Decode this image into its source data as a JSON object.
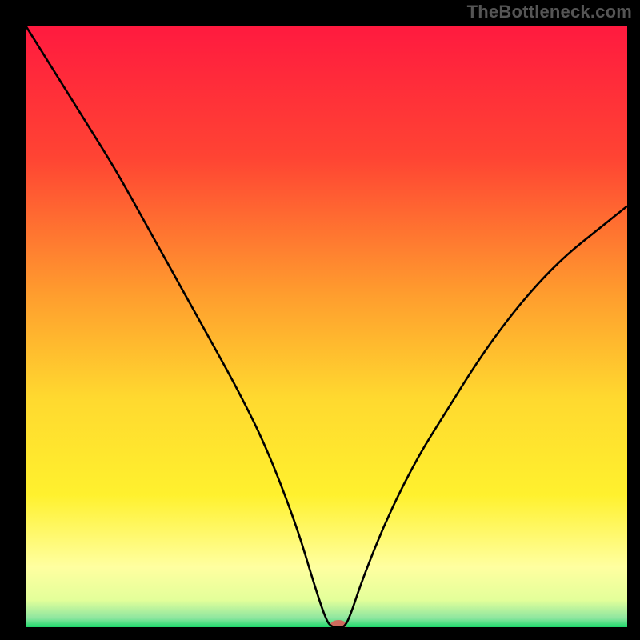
{
  "watermark": "TheBottleneck.com",
  "chart_data": {
    "type": "line",
    "title": "",
    "xlabel": "",
    "ylabel": "",
    "xlim": [
      0,
      100
    ],
    "ylim": [
      0,
      100
    ],
    "grid": false,
    "legend": false,
    "background_gradient": {
      "stops": [
        {
          "offset": 0.0,
          "color": "#ff1a3f"
        },
        {
          "offset": 0.22,
          "color": "#ff4433"
        },
        {
          "offset": 0.45,
          "color": "#ff9e2e"
        },
        {
          "offset": 0.62,
          "color": "#ffd92f"
        },
        {
          "offset": 0.78,
          "color": "#fff12e"
        },
        {
          "offset": 0.9,
          "color": "#ffffa0"
        },
        {
          "offset": 0.955,
          "color": "#e3ff9a"
        },
        {
          "offset": 0.985,
          "color": "#8de6a0"
        },
        {
          "offset": 1.0,
          "color": "#1ed76b"
        }
      ]
    },
    "series": [
      {
        "name": "bottleneck-curve",
        "color": "#000000",
        "x": [
          0,
          5,
          10,
          15,
          20,
          25,
          30,
          35,
          40,
          45,
          48,
          50,
          51,
          52,
          53,
          54,
          56,
          60,
          65,
          70,
          75,
          80,
          85,
          90,
          95,
          100
        ],
        "y": [
          100,
          92,
          84,
          76,
          67,
          58,
          49,
          40,
          30,
          17,
          7,
          1,
          0,
          0,
          0,
          2,
          8,
          18,
          28,
          36,
          44,
          51,
          57,
          62,
          66,
          70
        ]
      }
    ],
    "marker": {
      "name": "optimal-point",
      "x": 52,
      "y": 0,
      "color": "#cf6a5d",
      "rx": 10,
      "ry": 6
    }
  }
}
